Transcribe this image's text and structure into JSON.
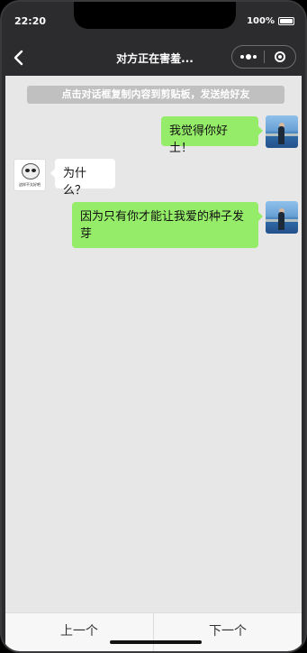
{
  "status": {
    "time": "22:20",
    "battery": "100%"
  },
  "nav": {
    "title": "对方正在害羞..."
  },
  "hint": "点击对话框复制内容到剪贴板，发送给好友",
  "messages": [
    {
      "side": "me",
      "text": "我觉得你好土！"
    },
    {
      "side": "other",
      "text": "为什么？"
    },
    {
      "side": "me",
      "text": "因为只有你才能让我爱的种子发芽"
    }
  ],
  "other_avatar_caption": "这样不太好吧",
  "footer": {
    "prev": "上一个",
    "next": "下一个"
  }
}
